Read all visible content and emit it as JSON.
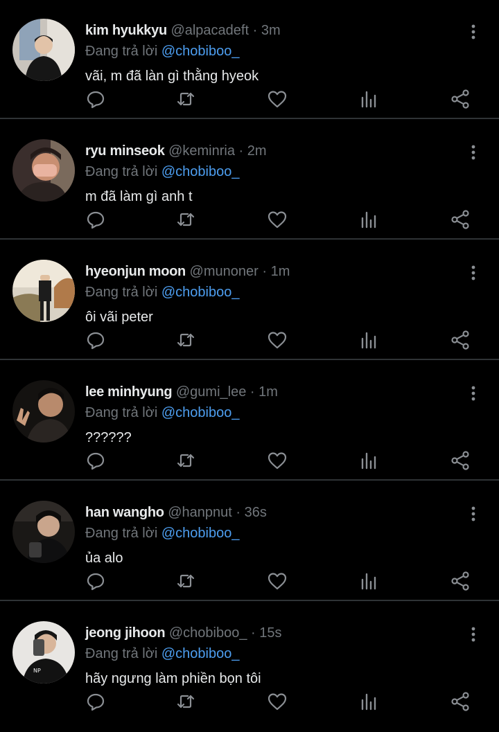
{
  "colors": {
    "background": "#000000",
    "divider": "#2f3336",
    "name": "#e7e9ea",
    "secondary": "#71767b",
    "mention": "#4d9ef0"
  },
  "icons": [
    "reply-icon",
    "retweet-icon",
    "like-icon",
    "views-icon",
    "share-icon",
    "more-options-icon"
  ],
  "tweets": [
    {
      "name": "kim hyukkyu",
      "handle": "@alpacadeft",
      "dot": "·",
      "time": "3m",
      "replying_prefix": "Đang trả lời",
      "replying_to": "@chobiboo_",
      "text": "vãi, m đã làn gì thằng hyeok"
    },
    {
      "name": "ryu minseok",
      "handle": "@keminria",
      "dot": "·",
      "time": "2m",
      "replying_prefix": "Đang trả lời",
      "replying_to": "@chobiboo_",
      "text": "m đã làm gì anh t"
    },
    {
      "name": "hyeonjun moon",
      "handle": "@munoner",
      "dot": "·",
      "time": "1m",
      "replying_prefix": "Đang trả lời",
      "replying_to": "@chobiboo_",
      "text": "ôi vãi peter"
    },
    {
      "name": "lee minhyung",
      "handle": "@gumi_lee",
      "dot": "·",
      "time": "1m",
      "replying_prefix": "Đang trả lời",
      "replying_to": "@chobiboo_",
      "text": "??????"
    },
    {
      "name": "han wangho",
      "handle": "@hanpnut",
      "dot": "·",
      "time": "36s",
      "replying_prefix": "Đang trả lời",
      "replying_to": "@chobiboo_",
      "text": "ủa alo"
    },
    {
      "name": "jeong jihoon",
      "handle": "@chobiboo_",
      "dot": "·",
      "time": "15s",
      "replying_prefix": "Đang trả lời",
      "replying_to": "@chobiboo_",
      "text": "hãy ngưng làm phiền bọn tôi"
    }
  ]
}
